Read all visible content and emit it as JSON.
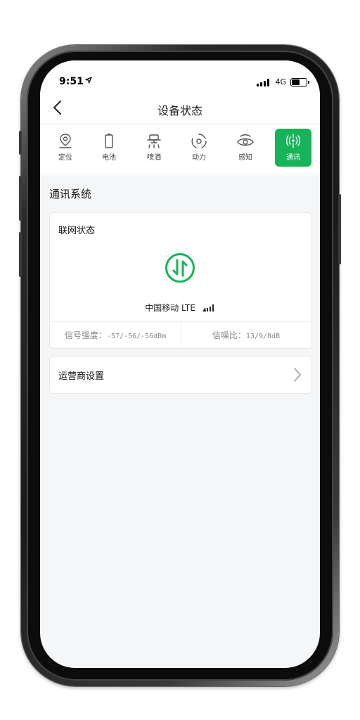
{
  "status_bar": {
    "time": "9:51",
    "network": "4G"
  },
  "nav": {
    "title": "设备状态"
  },
  "tabs": [
    {
      "label": "定位",
      "icon": "location-icon",
      "active": false
    },
    {
      "label": "电池",
      "icon": "battery-icon",
      "active": false
    },
    {
      "label": "喷洒",
      "icon": "spray-icon",
      "active": false
    },
    {
      "label": "动力",
      "icon": "power-icon",
      "active": false
    },
    {
      "label": "感知",
      "icon": "perception-icon",
      "active": false
    },
    {
      "label": "通讯",
      "icon": "communication-icon",
      "active": true
    }
  ],
  "section": {
    "title": "通讯系统"
  },
  "network_card": {
    "title": "联网状态",
    "carrier": "中国移动 LTE",
    "signal_strength_label": "信号强度：",
    "signal_strength_value": "-57/-56/-56dBm",
    "snr_label": "信噪比：",
    "snr_value": "13/9/8dB"
  },
  "operator": {
    "label": "运营商设置"
  },
  "colors": {
    "accent": "#16b358",
    "background": "#f5f6f7"
  }
}
